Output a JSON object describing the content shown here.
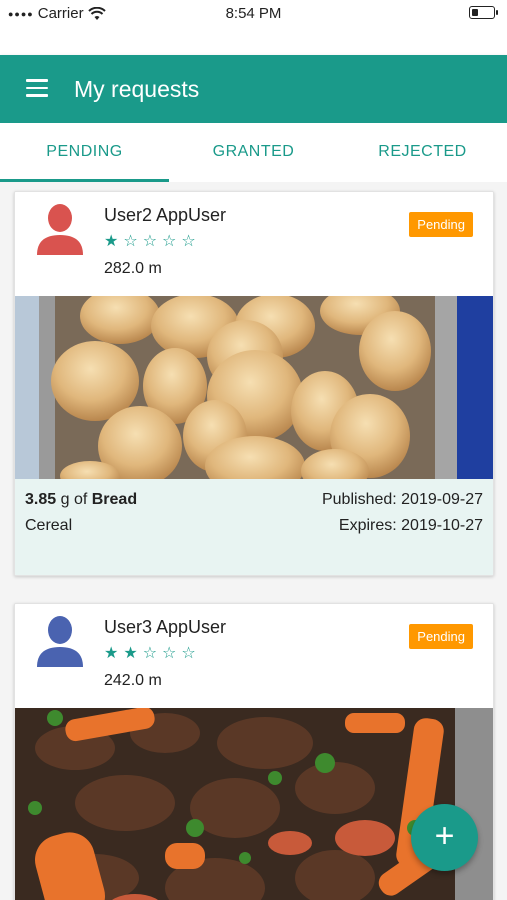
{
  "status_bar": {
    "carrier": "Carrier",
    "time": "8:54 PM",
    "battery_level": 0.3
  },
  "app_bar": {
    "title": "My requests",
    "menu_icon": "menu-icon"
  },
  "tabs": [
    {
      "label": "PENDING",
      "active": true
    },
    {
      "label": "GRANTED",
      "active": false
    },
    {
      "label": "REJECTED",
      "active": false
    }
  ],
  "requests": [
    {
      "user_name": "User2 AppUser",
      "avatar_color": "#d9534f",
      "rating": 1,
      "rating_max": 5,
      "distance": "282.0 m",
      "status": "Pending",
      "quantity": "3.85",
      "unit": "g of",
      "food": "Bread",
      "category": "Cereal",
      "published": "Published: 2019-09-27",
      "expires": "Expires: 2019-10-27",
      "photo": "bread-rolls-image"
    },
    {
      "user_name": "User3 AppUser",
      "avatar_color": "#4a63b0",
      "rating": 2,
      "rating_max": 5,
      "distance": "242.0 m",
      "status": "Pending",
      "photo": "beef-stir-fry-image"
    }
  ],
  "fab": {
    "label": "+",
    "icon": "add-icon"
  },
  "colors": {
    "primary": "#1a9a8a",
    "badge": "#ff9800",
    "footer_bg": "#e8f4f2"
  }
}
